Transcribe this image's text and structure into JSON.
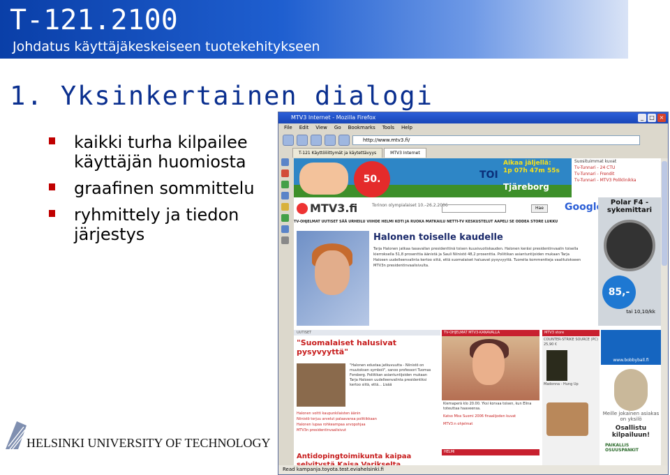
{
  "header": {
    "course_code": "T-121.2100",
    "course_name": "Johdatus käyttäjäkeskeiseen tuotekehitykseen"
  },
  "slide": {
    "title": "1. Yksinkertainen dialogi",
    "bullets": [
      "kaikki turha kilpailee käyttäjän huomiosta",
      "graafinen sommittelu",
      "ryhmittely ja tiedon järjestys"
    ]
  },
  "footer": {
    "university": "HELSINKI UNIVERSITY OF TECHNOLOGY"
  },
  "browser": {
    "window_title": "MTV3 Internet - Mozilla Firefox",
    "menu": [
      "File",
      "Edit",
      "View",
      "Go",
      "Bookmarks",
      "Tools",
      "Help"
    ],
    "url": "http://www.mtv3.fi/",
    "tabs": [
      "T-121 Käyttöliittymät ja käytettävyys",
      "MTV3 Internet"
    ],
    "status": "Read kampanja.toyota.test.eviahelsinki.fi"
  },
  "page": {
    "ad": {
      "badge": "50.",
      "brand_partial": "TOI",
      "promo_line1": "Aikaa jäljellä:",
      "promo_line2": "1p 07h 47m 55s",
      "brand": "Tjäreborg"
    },
    "side_links": [
      "Suosituimmat kuvat",
      "Tv-Tunnari - 24 CTU",
      "Tv-Tunnari - Frendit",
      "Tv-Tunnari - MTV3 Poliklinikka"
    ],
    "logo": "MTV3.fi",
    "olympics": "Torinon olympialaiset 10.–26.2.2006",
    "search_button": "Hae",
    "google": "Google",
    "nav": "TV-OHJELMAT  UUTISET  SÄÄ  URHEILU  VIIHDE  HELMI  KOTI JA RUOKA  MATKAILU  NETTI-TV  KESKUSTELUT  AAPELI  SE ODDEA  STORE  LUKKU",
    "headline": "Halonen toiselle kaudelle",
    "article": "Tarja Halonen jatkaa tasavallan presidenttinä toisen kuusivuotiskauden. Halonen keräsi presidentinvaalin toisella kierroksella 51,8 prosenttia äänistä ja Sauli Niinistö 48,2 prosenttia. Poliitikan asiantuntijoiden mukaan Tarja Halosen uudelleenvalinta kertoo siitä, että suomalaiset haluavat pysyvyyttä. Tuoreita kommentteja vaalitulokseen MTV3n presidentinvaalisivulta.",
    "mid_section_label": "UUTISET",
    "mid_headline": "\"Suomalaiset halusivat pysyvyyttä\"",
    "mid_text": "\"Halonen edustaa jatkuvuutta - Niinistö on muutoksen symboli\", sanoo professori Tuomas Forsberg. Poliitikan asiantuntijoiden mukaan Tarja Halosen uudelleenvalinta presidentiksi kertoo siitä, että... Lisää",
    "red_links": [
      "Halonen voitti kaupunkilaisten äänin",
      "Niinistö torjuu arvelut palaavansa politiikkaan",
      "Halonen lupaa rohkeampaa arvopohjaa",
      "MTV3n presidentinvaalisivut"
    ],
    "anti_headline": "Antidopingtoimikunta kaipaa selvitystä Kaisa Varikselta",
    "center_label": "TV-OHJELMAT  MTV3-KANAVALLA",
    "center_text": "Kiemaperä klo 20.00. Yksi korvaa toisen, kun Elina toteuttaa haaveensa.",
    "center_links": [
      "Katso Miss Suomi 2006 finaalijoden kuvat",
      "MTV3:n ohjelmat"
    ],
    "center_bar2": "HELMI",
    "store_label": "MTV3 store",
    "store_text": "COUNTER-STRIKE SOURCE (PC) 25,90 €",
    "store_item2": "Madonna - Hung Up",
    "polar_title": "Polar F4 -sykemittari",
    "polar_price": "85,-",
    "polar_sub": "tai 10,10/kk",
    "polar_site": "www.bobbyball.fi",
    "meille": "Meille jokainen asiakas on yksilö",
    "osallistu": "Osallistu kilpailuun!",
    "paikallis": "PAIKALLIS OSUUSPANKIT"
  },
  "colors": {
    "header_blue": "#1f5fd0",
    "title_blue": "#0a2f8f",
    "bullet_red": "#c00000",
    "mtv_red": "#c71c1c"
  }
}
